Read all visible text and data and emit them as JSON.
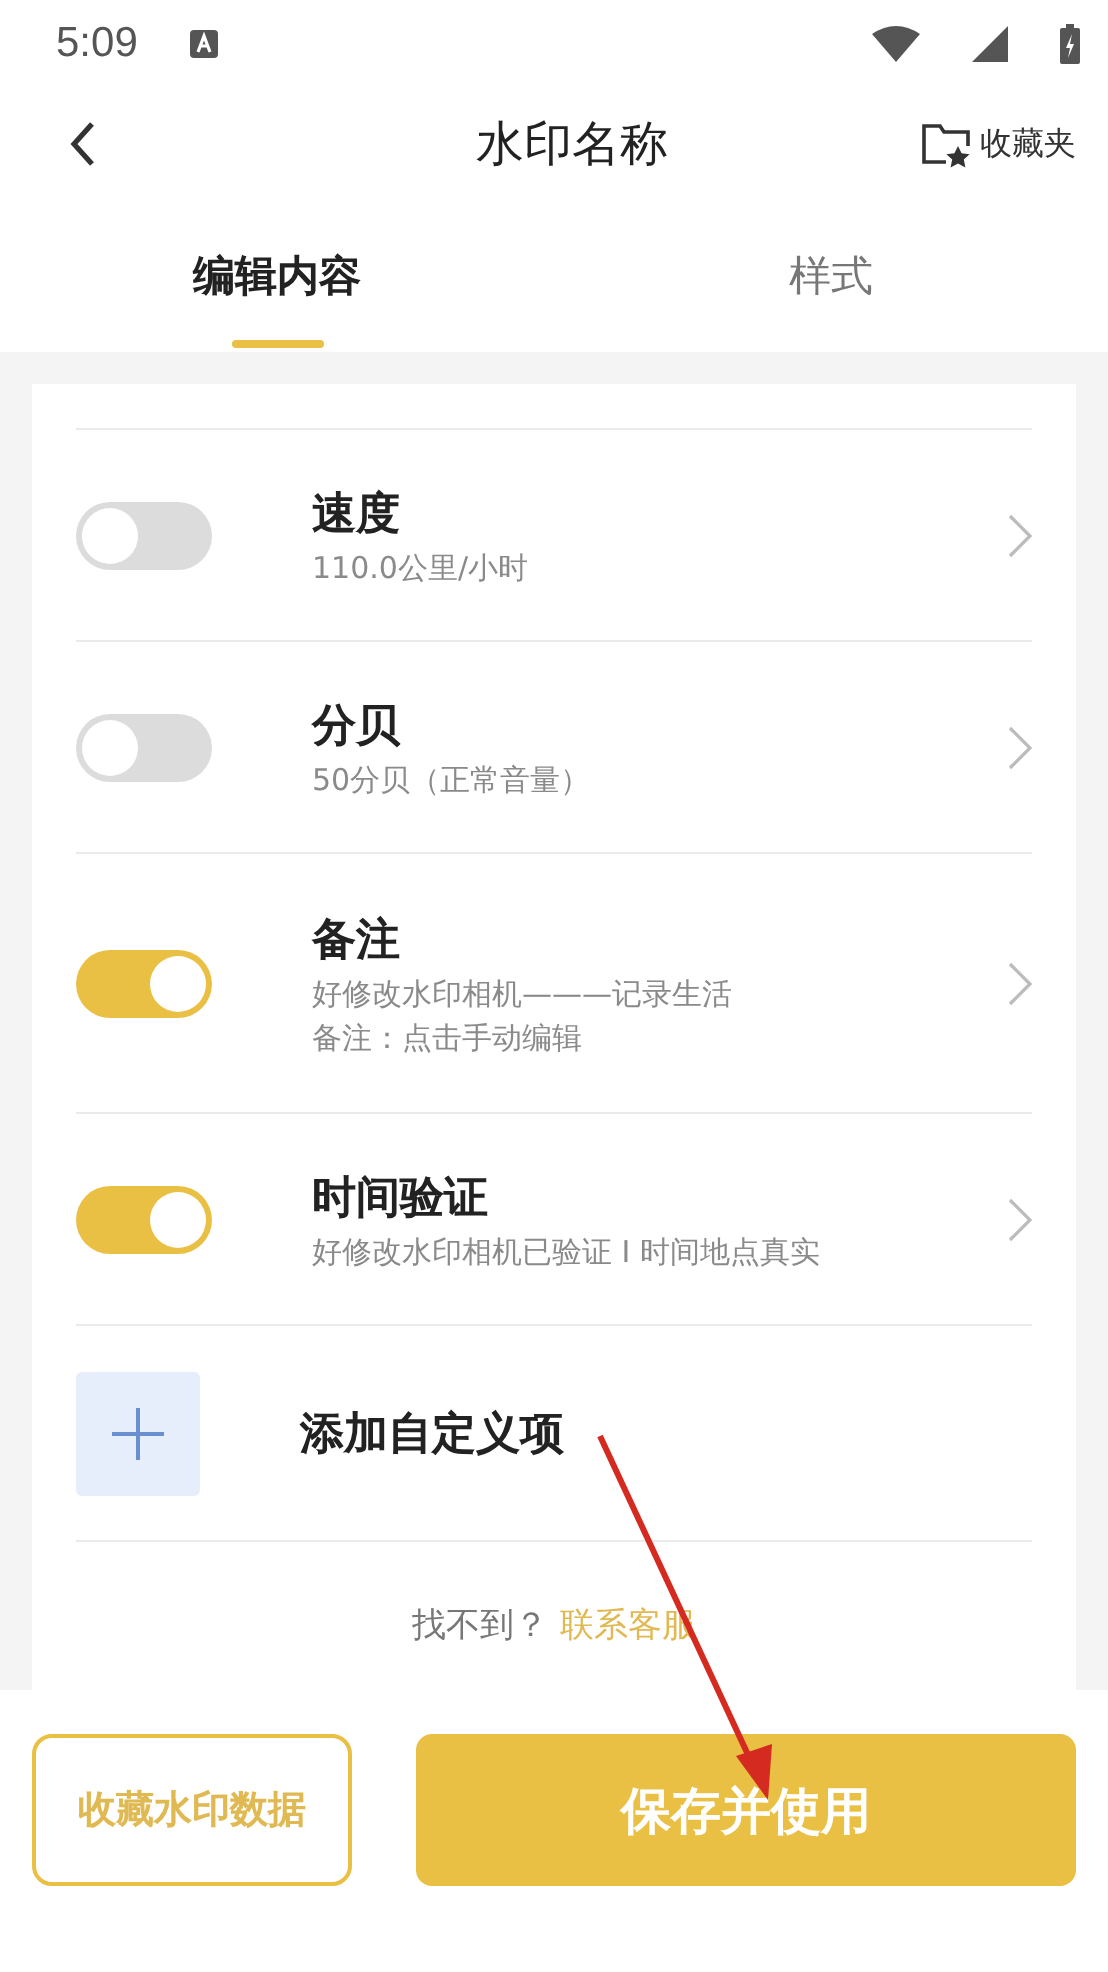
{
  "status_bar": {
    "time": "5:09"
  },
  "header": {
    "title": "水印名称",
    "favorites_label": "收藏夹"
  },
  "tabs": [
    {
      "label": "编辑内容",
      "selected": true
    },
    {
      "label": "样式",
      "selected": false
    }
  ],
  "items": [
    {
      "title": "速度",
      "details": [
        "110.0公里/小时"
      ],
      "on": false
    },
    {
      "title": "分贝",
      "details": [
        "50分贝（正常音量）"
      ],
      "on": false
    },
    {
      "title": "备注",
      "details": [
        "好修改水印相机———记录生活",
        "备注：点击手动编辑"
      ],
      "on": true
    },
    {
      "title": "时间验证",
      "details": [
        "好修改水印相机已验证 I 时间地点真实"
      ],
      "on": true
    }
  ],
  "add_item": {
    "label": "添加自定义项"
  },
  "help": {
    "text": "找不到？",
    "link": "联系客服"
  },
  "buttons": {
    "secondary": "收藏水印数据",
    "primary": "保存并使用"
  }
}
